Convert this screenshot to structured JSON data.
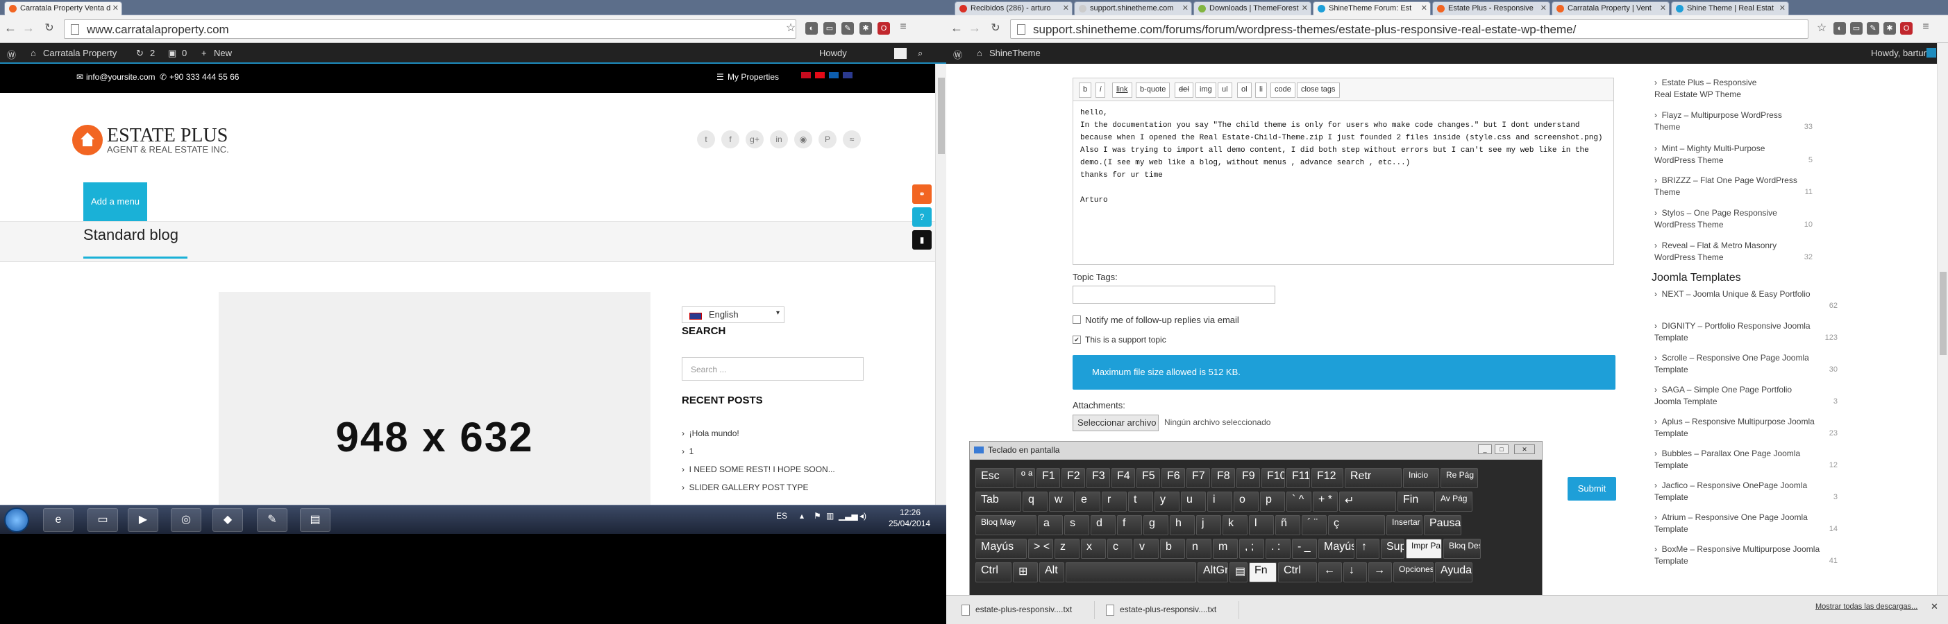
{
  "left": {
    "tabs": [
      {
        "label": "Carratala Property Venta d",
        "active": true
      }
    ],
    "url": "www.carratalaproperty.com",
    "wpbar": {
      "site": "Carratala Property",
      "updates": "2",
      "comments": "0",
      "new": "New",
      "howdy": "Howdy"
    },
    "topinfo": {
      "email": "info@yoursite.com",
      "phone": "+90 333 444 55 66",
      "my_properties": "My Properties"
    },
    "brand": {
      "name": "ESTATE PLUS",
      "tagline": "AGENT & REAL ESTATE INC."
    },
    "social_icons": [
      "twitter-icon",
      "facebook-icon",
      "google-plus-icon",
      "linkedin-icon",
      "github-icon",
      "pinterest-icon",
      "rss-icon"
    ],
    "add_menu": "Add a menu",
    "page_title": "Standard blog",
    "placeholder_size": "948 x 632",
    "language": "English",
    "search_heading": "SEARCH",
    "search_placeholder": "Search ...",
    "recent_heading": "RECENT POSTS",
    "recent_posts": [
      "¡Hola mundo!",
      "1",
      "I NEED SOME REST! I HOPE SOON...",
      "SLIDER GALLERY POST TYPE"
    ],
    "taskbar": {
      "lang": "ES",
      "time": "12:26",
      "date": "25/04/2014"
    }
  },
  "right": {
    "tabs": [
      {
        "label": "Recibidos (286) - arturo",
        "active": false
      },
      {
        "label": "support.shinetheme.com",
        "active": false
      },
      {
        "label": "Downloads | ThemeForest",
        "active": false
      },
      {
        "label": "ShineTheme Forum: Est",
        "active": true
      },
      {
        "label": "Estate Plus - Responsive",
        "active": false
      },
      {
        "label": "Carratala Property | Vent",
        "active": false
      },
      {
        "label": "Shine Theme | Real Estat",
        "active": false
      }
    ],
    "url": "support.shinetheme.com/forums/forum/wordpress-themes/estate-plus-responsive-real-estate-wp-theme/",
    "wpbar": {
      "site": "ShineTheme",
      "howdy": "Howdy, barturo"
    },
    "toolbar_buttons": [
      "b",
      "i",
      "link",
      "b-quote",
      "del",
      "img",
      "ul",
      "ol",
      "li",
      "code",
      "close tags"
    ],
    "editor_text": "hello,\nIn the documentation you say \"The child theme is only for users who make code changes.\" but I dont understand because when I opened the Real Estate-Child-Theme.zip I just founded 2 files inside (style.css and screenshot.png)\nAlso I was trying to import all demo content, I did both step without errors but I can't see my web like in the demo.(I see my web like a blog, without menus , advance search , etc...)\nthanks for ur time\n\nArturo",
    "topic_tags_label": "Topic Tags:",
    "notify_label": "Notify me of follow-up replies via email",
    "support_label": "This is a support topic",
    "notice": "Maximum file size allowed is 512 KB.",
    "attachments_label": "Attachments:",
    "file_button": "Seleccionar archivo",
    "file_status": "Ningún archivo seleccionado",
    "submit": "Submit",
    "sidebar_items": [
      {
        "title": "Estate Plus – Responsive Real Estate WP Theme",
        "count": ""
      },
      {
        "title": "Flayz – Multipurpose WordPress Theme",
        "count": "33"
      },
      {
        "title": "Mint – Mighty Multi-Purpose WordPress Theme",
        "count": "5"
      },
      {
        "title": "BRIZZZ – Flat One Page WordPress Theme",
        "count": "11"
      },
      {
        "title": "Stylos – One Page Responsive WordPress Theme",
        "count": "10"
      },
      {
        "title": "Reveal – Flat & Metro Masonry WordPress Theme",
        "count": "32"
      }
    ],
    "joomla_heading": "Joomla Templates",
    "joomla_items": [
      {
        "title": "NEXT – Joomla Unique & Easy Portfolio",
        "count": "62"
      },
      {
        "title": "DIGNITY – Portfolio Responsive Joomla Template",
        "count": "123"
      },
      {
        "title": "Scrolle – Responsive One Page Joomla Template",
        "count": "30"
      },
      {
        "title": "SAGA – Simple One Page Portfolio Joomla Template",
        "count": "3"
      },
      {
        "title": "Aplus – Responsive Multipurpose Joomla Template",
        "count": "23"
      },
      {
        "title": "Bubbles – Parallax One Page Joomla Template",
        "count": "12"
      },
      {
        "title": "Jacfico – Responsive OnePage Joomla Template",
        "count": "3"
      },
      {
        "title": "Atrium – Responsive One Page Joomla Template",
        "count": "14"
      },
      {
        "title": "BoxMe – Responsive Multipurpose Joomla Template",
        "count": "41"
      }
    ],
    "osk": {
      "title": "Teclado en pantalla",
      "rows": [
        [
          "Esc",
          "º ª",
          "F1",
          "F2",
          "F3",
          "F4",
          "F5",
          "F6",
          "F7",
          "F8",
          "F9",
          "F10",
          "F11",
          "F12",
          "Retr",
          "Inicio",
          "Re Pág"
        ],
        [
          "Tab",
          "q",
          "w",
          "e",
          "r",
          "t",
          "y",
          "u",
          "i",
          "o",
          "p",
          "` ^",
          "+ *",
          "↵",
          "Fin",
          "Av Pág"
        ],
        [
          "Bloq May",
          "a",
          "s",
          "d",
          "f",
          "g",
          "h",
          "j",
          "k",
          "l",
          "ñ",
          "´ ¨",
          "ç",
          "Insertar",
          "Pausa"
        ],
        [
          "Mayús",
          "> <",
          "z",
          "x",
          "c",
          "v",
          "b",
          "n",
          "m",
          ", ;",
          ". :",
          "- _",
          "Mayús",
          "↑",
          "Supr",
          "Impr Pant",
          "Bloq Despl"
        ],
        [
          "Ctrl",
          "⊞",
          "Alt",
          "",
          "AltGr",
          "▤",
          "Fn",
          "Ctrl",
          "←",
          "↓",
          "→",
          "Opciones",
          "Ayuda"
        ]
      ]
    },
    "downloads": [
      "estate-plus-responsiv....txt",
      "estate-plus-responsiv....txt"
    ],
    "show_all_downloads": "Mostrar todas las descargas..."
  },
  "colors": {
    "accent_blue": "#1e9fd8",
    "orange": "#f26522",
    "wp_bar": "#222222"
  }
}
